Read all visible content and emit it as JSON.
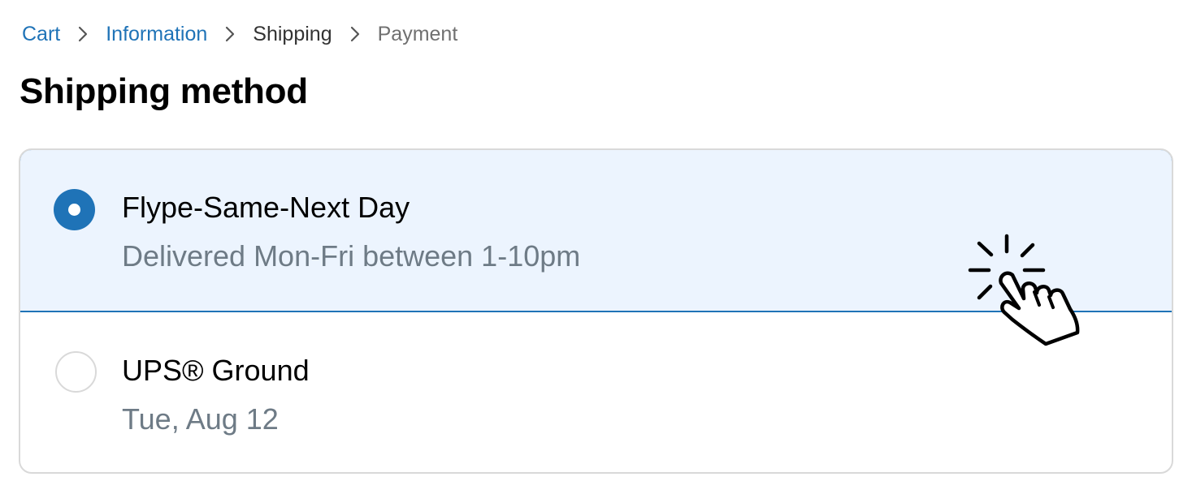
{
  "breadcrumb": {
    "items": [
      {
        "label": "Cart",
        "state": "link"
      },
      {
        "label": "Information",
        "state": "link"
      },
      {
        "label": "Shipping",
        "state": "current"
      },
      {
        "label": "Payment",
        "state": "future"
      }
    ]
  },
  "shipping": {
    "title": "Shipping method",
    "options": [
      {
        "name": "Flype-Same-Next Day",
        "detail": "Delivered Mon-Fri between 1-10pm",
        "selected": true
      },
      {
        "name": "UPS® Ground",
        "detail": "Tue, Aug 12",
        "selected": false
      }
    ]
  },
  "icons": {
    "separator": "chevron-right-icon",
    "pointer": "hand-pointer-click-icon"
  },
  "colors": {
    "accent": "#1f73b7",
    "selected_background": "#ecf4fe",
    "border": "#d9d9d9",
    "muted_text": "#6e7b86"
  }
}
